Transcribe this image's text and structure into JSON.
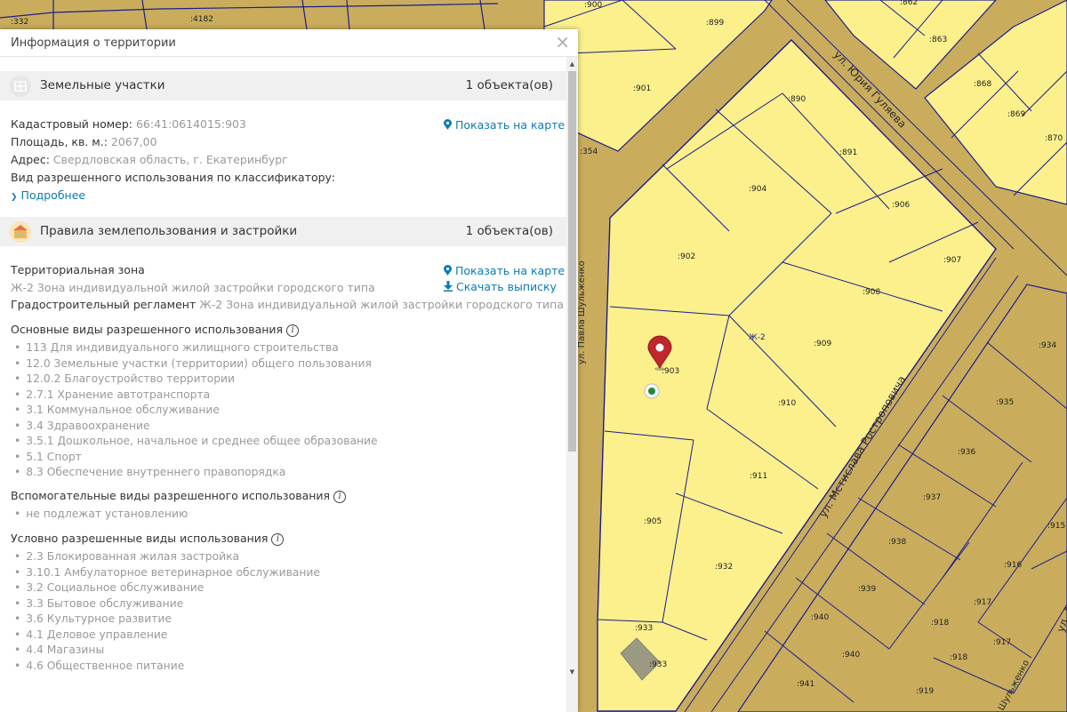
{
  "panel": {
    "title": "Информация о территории",
    "close_glyph": "×"
  },
  "land_plots": {
    "title": "Земельные участки",
    "count": "1 объекта(ов)",
    "cadastral_label": "Кадастровый номер:",
    "cadastral_value": "66:41:0614015:903",
    "area_label": "Площадь, кв. м.:",
    "area_value": "2067,00",
    "address_label": "Адрес:",
    "address_value": "Свердловская область, г. Екатеринбург",
    "use_label": "Вид разрешенного использования по классификатору:",
    "details_label": "Подробнее",
    "show_on_map": "Показать на карте"
  },
  "zoning": {
    "title": "Правила землепользования и застройки",
    "count": "1 объекта(ов)",
    "zone_label": "Территориальная зона",
    "zone_value": "Ж-2 Зона индивидуальной жилой застройки городского типа",
    "regulation_label": "Градостроительный регламент",
    "regulation_value": "Ж-2 Зона индивидуальной жилой застройки городского типа",
    "show_on_map": "Показать на карте",
    "download": "Скачать выписку"
  },
  "main_uses": {
    "title": "Основные виды разрешенного использования",
    "items": [
      "113 Для индивидуального жилищного строительства",
      "12.0 Земельные участки (территории) общего пользования",
      "12.0.2 Благоустройство территории",
      "2.7.1 Хранение автотранспорта",
      "3.1 Коммунальное обслуживание",
      "3.4 Здравоохранение",
      "3.5.1 Дошкольное, начальное и среднее общее образование",
      "5.1 Спорт",
      "8.3 Обеспечение внутреннего правопорядка"
    ]
  },
  "aux_uses": {
    "title": "Вспомогательные виды разрешенного использования",
    "items": [
      "не подлежат установлению"
    ]
  },
  "cond_uses": {
    "title": "Условно разрешенные виды использования",
    "items": [
      "2.3 Блокированная жилая застройка",
      "3.10.1 Амбулаторное ветеринарное обслуживание",
      "3.2 Социальное обслуживание",
      "3.3 Бытовое обслуживание",
      "3.6 Культурное развитие",
      "4.1 Деловое управление",
      "4.4 Магазины",
      "4.6 Общественное питание"
    ]
  },
  "map": {
    "streets": {
      "gulyaeva": "ул. Юрия Гуляева",
      "rostropovicha": "ул. Мстислава Ростроповича",
      "left_street": "ул. Павла Шульженко",
      "bottom_right": "Шульженко",
      "right_edge": "ул. А"
    },
    "zone_label": "Ж-2",
    "colors": {
      "plot_fill": "#fbf08c",
      "zone_fill": "#c9ad5d",
      "boundary": "#1c1c8c",
      "road": "#c2a357",
      "pin": "#c0262c",
      "link": "#0a7bb6"
    },
    "plot_labels": {
      "p332": ":332",
      "p4182": ":4182",
      "p900": ":900",
      "p899": ":899",
      "p862": ":862",
      "p863": ":863",
      "p901": ":901",
      "p890": ":890",
      "p868": ":868",
      "p869": ":869",
      "p870": ":870",
      "p354": ":354",
      "p891": ":891",
      "p904": ":904",
      "p906": ":906",
      "p902": ":902",
      "p907": ":907",
      "p908": ":908",
      "pzh2": "Ж-2",
      "p909": ":909",
      "p903": ":903",
      "p934": ":934",
      "p910": ":910",
      "p935": ":935",
      "p936": ":936",
      "p911": ":911",
      "p937": ":937",
      "p905": ":905",
      "p915": ":915",
      "p938": ":938",
      "p932": ":932",
      "p916": ":916",
      "p939": ":939",
      "p917a": ":917",
      "p940a": ":940",
      "p918a": ":918",
      "p933a": ":933",
      "p917b": ":917",
      "p933b": ":933",
      "p940b": ":940",
      "p918b": ":918",
      "p941": ":941",
      "p919": ":919"
    }
  }
}
